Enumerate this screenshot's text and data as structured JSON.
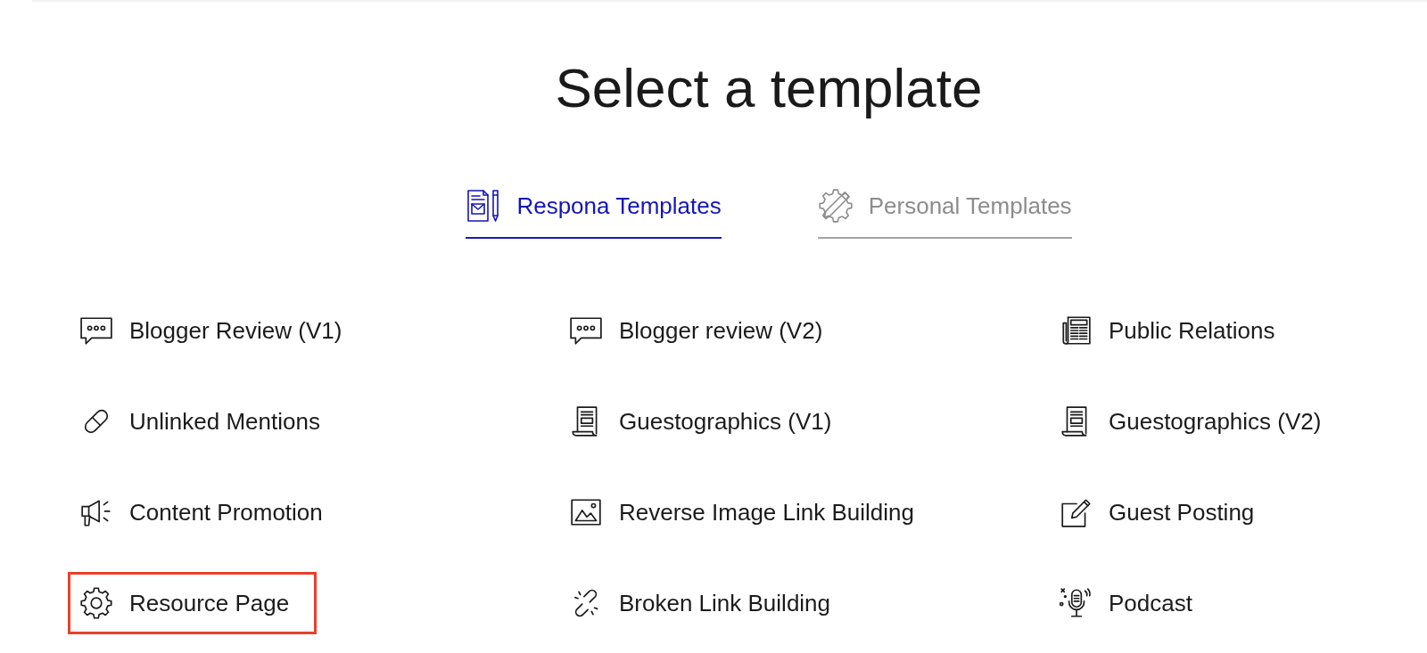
{
  "title": "Select a template",
  "tabs": [
    {
      "label": "Respona Templates",
      "selected": true,
      "kind": "letter"
    },
    {
      "label": "Personal Templates",
      "selected": false,
      "kind": "gearpencil"
    }
  ],
  "templates": [
    {
      "label": "Blogger Review (V1)",
      "kind": "chat",
      "highlighted": false
    },
    {
      "label": "Blogger review (V2)",
      "kind": "chat",
      "highlighted": false
    },
    {
      "label": "Public Relations",
      "kind": "newspaper",
      "highlighted": false
    },
    {
      "label": "Unlinked Mentions",
      "kind": "capsule",
      "highlighted": false
    },
    {
      "label": "Guestographics (V1)",
      "kind": "scroll",
      "highlighted": false
    },
    {
      "label": "Guestographics (V2)",
      "kind": "scroll",
      "highlighted": false
    },
    {
      "label": "Content Promotion",
      "kind": "megaphone",
      "highlighted": false
    },
    {
      "label": "Reverse Image Link Building",
      "kind": "picture",
      "highlighted": false
    },
    {
      "label": "Guest Posting",
      "kind": "edit",
      "highlighted": false
    },
    {
      "label": "Resource Page",
      "kind": "gear",
      "highlighted": true
    },
    {
      "label": "Broken Link Building",
      "kind": "brokenlink",
      "highlighted": false
    },
    {
      "label": "Podcast",
      "kind": "microphone",
      "highlighted": false
    }
  ]
}
